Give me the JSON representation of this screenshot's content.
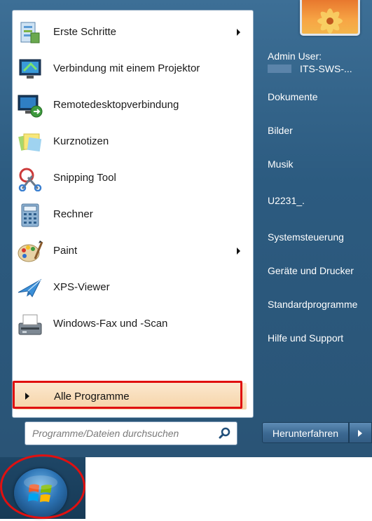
{
  "left_pane": {
    "items": [
      {
        "label": "Erste Schritte",
        "icon": "getting-started-icon",
        "submenu": true
      },
      {
        "label": "Verbindung mit einem Projektor",
        "icon": "projector-icon",
        "submenu": false
      },
      {
        "label": "Remotedesktopverbindung",
        "icon": "remote-desktop-icon",
        "submenu": false
      },
      {
        "label": "Kurznotizen",
        "icon": "sticky-notes-icon",
        "submenu": false
      },
      {
        "label": "Snipping Tool",
        "icon": "scissors-icon",
        "submenu": false
      },
      {
        "label": "Rechner",
        "icon": "calculator-icon",
        "submenu": false
      },
      {
        "label": "Paint",
        "icon": "paint-palette-icon",
        "submenu": true
      },
      {
        "label": "XPS-Viewer",
        "icon": "xps-viewer-icon",
        "submenu": false
      },
      {
        "label": "Windows-Fax und -Scan",
        "icon": "fax-scanner-icon",
        "submenu": false
      }
    ],
    "all_programs": "Alle Programme",
    "search_placeholder": "Programme/Dateien durchsuchen"
  },
  "right_pane": {
    "user_line1": "Admin User:",
    "user_line2": "ITS-SWS-...",
    "items": [
      "Dokumente",
      "Bilder",
      "Musik",
      "U2231_.",
      "Systemsteuerung",
      "Geräte und Drucker",
      "Standardprogramme",
      "Hilfe und Support"
    ],
    "shutdown": "Herunterfahren"
  },
  "colors": {
    "highlight": "#e01010",
    "pane_blue": "#2c5b80"
  }
}
